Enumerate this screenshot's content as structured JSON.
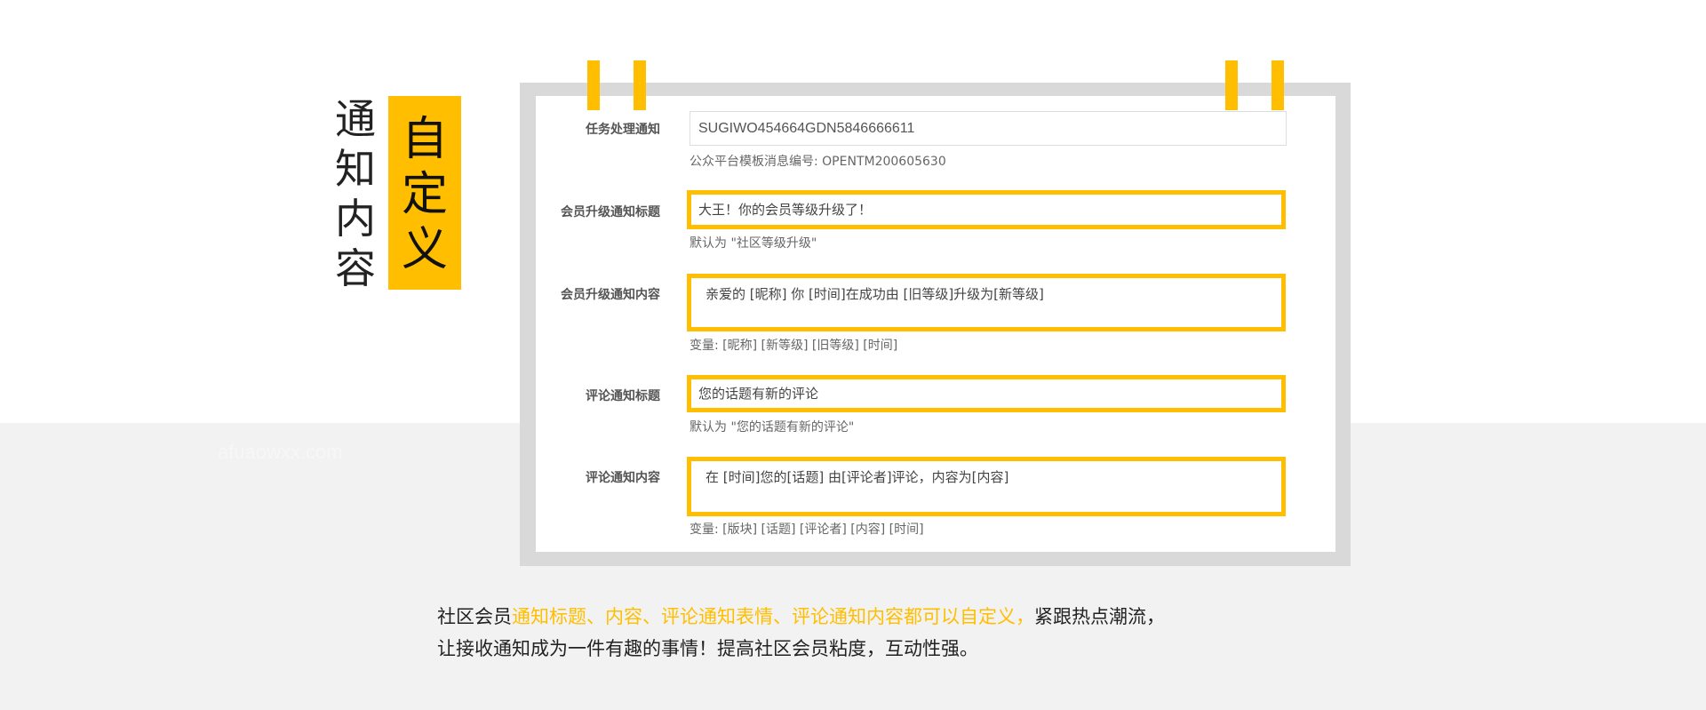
{
  "watermark": "afuaowxx.com",
  "title": {
    "plain": "通知内容",
    "highlight": "自定义"
  },
  "form": {
    "rows": [
      {
        "label": "任务处理通知",
        "value": "SUGIWO454664GDN5846666611",
        "hint": "公众平台模板消息编号: OPENTM200605630"
      },
      {
        "label": "会员升级通知标题",
        "value": "大王！你的会员等级升级了！",
        "hint": "默认为 \"社区等级升级\""
      },
      {
        "label": "会员升级通知内容",
        "value": "亲爱的 [昵称] 你 [时间]在成功由 [旧等级]升级为[新等级]",
        "hint": "变量: [昵称] [新等级] [旧等级] [时间]"
      },
      {
        "label": "评论通知标题",
        "value": "您的话题有新的评论",
        "hint": "默认为 \"您的话题有新的评论\""
      },
      {
        "label": "评论通知内容",
        "value": "在 [时间]您的[话题] 由[评论者]评论，内容为[内容]",
        "hint": "变量: [版块] [话题] [评论者] [内容] [时间]"
      }
    ]
  },
  "caption": {
    "line1_prefix": "社区会员",
    "line1_accent": "通知标题、内容、评论通知表情、评论通知内容都可以自定义，",
    "line1_suffix": "紧跟热点潮流，",
    "line2": "让接收通知成为一件有趣的事情！提高社区会员粘度，互动性强。"
  },
  "colors": {
    "accent": "#ffbe00",
    "frame": "#d9d9d9",
    "band": "#f2f2f2"
  }
}
